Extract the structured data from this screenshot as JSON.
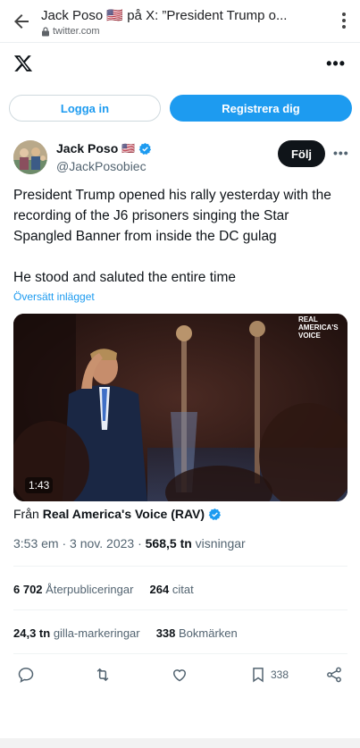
{
  "browser": {
    "title": "Jack Poso 🇺🇸 på X: ”President Trump o...",
    "url": "twitter.com"
  },
  "auth": {
    "login_label": "Logga in",
    "signup_label": "Registrera dig"
  },
  "author": {
    "name": "Jack Poso",
    "flag": "🇺🇸",
    "handle": "@JackPosobiec",
    "follow_label": "Följ"
  },
  "tweet": {
    "line1": "President Trump opened his rally yesterday with the",
    "line2": "recording of the J6 prisoners singing the Star",
    "line3": "Spangled Banner from inside the DC gulag",
    "line4": "He stood and saluted the entire time",
    "translate_label": "Översätt inlägget"
  },
  "video": {
    "duration": "1:43",
    "watermark_line1": "REAL",
    "watermark_line2": "AMERICA'S",
    "watermark_line3": "VOICE"
  },
  "source": {
    "prefix": "Från",
    "name": "Real America's Voice (RAV)"
  },
  "meta": {
    "time": "3:53 em",
    "date": "3 nov. 2023",
    "views_count": "568,5 tn",
    "views_label": "visningar"
  },
  "stats": {
    "reposts_count": "6 702",
    "reposts_label": "Återpubliceringar",
    "quotes_count": "264",
    "quotes_label": "citat",
    "likes_count": "24,3 tn",
    "likes_label": "gilla-markeringar",
    "bookmarks_count": "338",
    "bookmarks_label": "Bokmärken"
  },
  "actions": {
    "bookmark_count": "338"
  },
  "colors": {
    "accent": "#1d9bf0",
    "text": "#0f1419",
    "secondary": "#536471"
  }
}
